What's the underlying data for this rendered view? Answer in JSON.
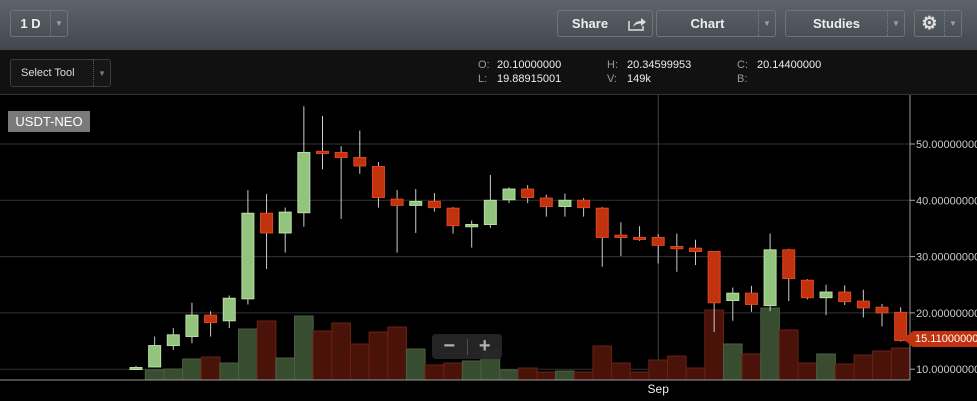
{
  "toolbar": {
    "interval": "1 D",
    "share_label": "Share",
    "chart_label": "Chart",
    "studies_label": "Studies",
    "settings_icon": "gear-icon",
    "share_icon": "share-arrow-icon",
    "dropdown_icon": "caret-down-icon"
  },
  "drawing": {
    "select_tool": "Select Tool"
  },
  "ohlc": {
    "o_label": "O:",
    "o": "20.10000000",
    "h_label": "H:",
    "h": "20.34599953",
    "c_label": "C:",
    "c": "20.14400000",
    "l_label": "L:",
    "l": "19.88915001",
    "v_label": "V:",
    "v": "149k",
    "b_label": "B:"
  },
  "symbol": "USDT-NEO",
  "zoom_controls": {
    "minus": "−",
    "plus": "+"
  },
  "last_price": "15.11000000",
  "colors": {
    "up": "#93c47d",
    "down": "#c1320f",
    "up_volume": "#384c30",
    "down_volume": "#4a130a"
  },
  "chart_data": {
    "type": "candlestick",
    "x_tick_labels": [
      "Sep"
    ],
    "x_tick_index": 28,
    "y_ticks": [
      "10.00000000",
      "20.00000000",
      "30.00000000",
      "40.00000000",
      "50.00000000"
    ],
    "ylim": [
      7,
      57
    ],
    "grid": true,
    "ohlc": [
      [
        10.1,
        10.6,
        10.0,
        10.3
      ],
      [
        10.4,
        15.8,
        10.3,
        14.2
      ],
      [
        14.2,
        17.3,
        13.4,
        16.1
      ],
      [
        15.8,
        21.8,
        14.6,
        19.6
      ],
      [
        19.6,
        20.3,
        15.8,
        18.3
      ],
      [
        18.6,
        23.1,
        17.3,
        22.6
      ],
      [
        22.5,
        41.8,
        21.5,
        37.7
      ],
      [
        37.7,
        41.1,
        27.8,
        34.2
      ],
      [
        34.2,
        38.7,
        30.7,
        37.9
      ],
      [
        37.8,
        56.7,
        35.3,
        48.5
      ],
      [
        48.7,
        55.0,
        45.5,
        48.3
      ],
      [
        48.5,
        49.6,
        36.7,
        47.6
      ],
      [
        47.6,
        52.4,
        44.7,
        46.1
      ],
      [
        46.0,
        46.8,
        38.7,
        40.5
      ],
      [
        40.2,
        41.8,
        30.7,
        39.1
      ],
      [
        39.1,
        42.0,
        34.2,
        39.8
      ],
      [
        39.8,
        41.3,
        38.0,
        38.7
      ],
      [
        38.6,
        38.8,
        34.1,
        35.5
      ],
      [
        35.3,
        36.4,
        31.6,
        35.7
      ],
      [
        35.7,
        44.5,
        35.1,
        40.0
      ],
      [
        40.1,
        42.3,
        39.5,
        42.0
      ],
      [
        42.0,
        42.7,
        39.5,
        40.5
      ],
      [
        40.4,
        41.0,
        37.1,
        38.9
      ],
      [
        38.9,
        41.2,
        37.1,
        40.0
      ],
      [
        40.0,
        40.4,
        37.1,
        38.7
      ],
      [
        38.6,
        38.8,
        28.2,
        33.4
      ],
      [
        33.8,
        36.1,
        30.1,
        33.4
      ],
      [
        33.4,
        35.4,
        32.8,
        33.1
      ],
      [
        33.4,
        34.0,
        28.8,
        32.0
      ],
      [
        31.8,
        34.1,
        27.3,
        31.4
      ],
      [
        31.5,
        33.0,
        28.5,
        30.9
      ],
      [
        30.9,
        30.9,
        16.6,
        21.8
      ],
      [
        22.2,
        24.5,
        18.6,
        23.5
      ],
      [
        23.5,
        24.8,
        20.2,
        21.5
      ],
      [
        21.3,
        34.1,
        20.3,
        31.2
      ],
      [
        31.2,
        31.4,
        22.1,
        26.1
      ],
      [
        25.8,
        26.0,
        22.4,
        22.7
      ],
      [
        22.7,
        25.0,
        19.6,
        23.7
      ],
      [
        23.7,
        24.9,
        21.4,
        22.0
      ],
      [
        22.1,
        24.1,
        19.2,
        20.9
      ],
      [
        21.0,
        21.6,
        17.6,
        20.0
      ],
      [
        20.1,
        21.0,
        14.9,
        15.1
      ]
    ],
    "volume_relative": [
      0,
      10,
      11,
      21,
      23,
      17,
      51,
      59,
      22,
      64,
      49,
      57,
      36,
      48,
      53,
      31,
      15,
      17,
      19,
      31,
      10,
      12,
      8,
      9,
      8,
      34,
      17,
      8,
      20,
      24,
      12,
      70,
      36,
      26,
      72,
      50,
      17,
      26,
      16,
      25,
      29,
      32
    ]
  }
}
